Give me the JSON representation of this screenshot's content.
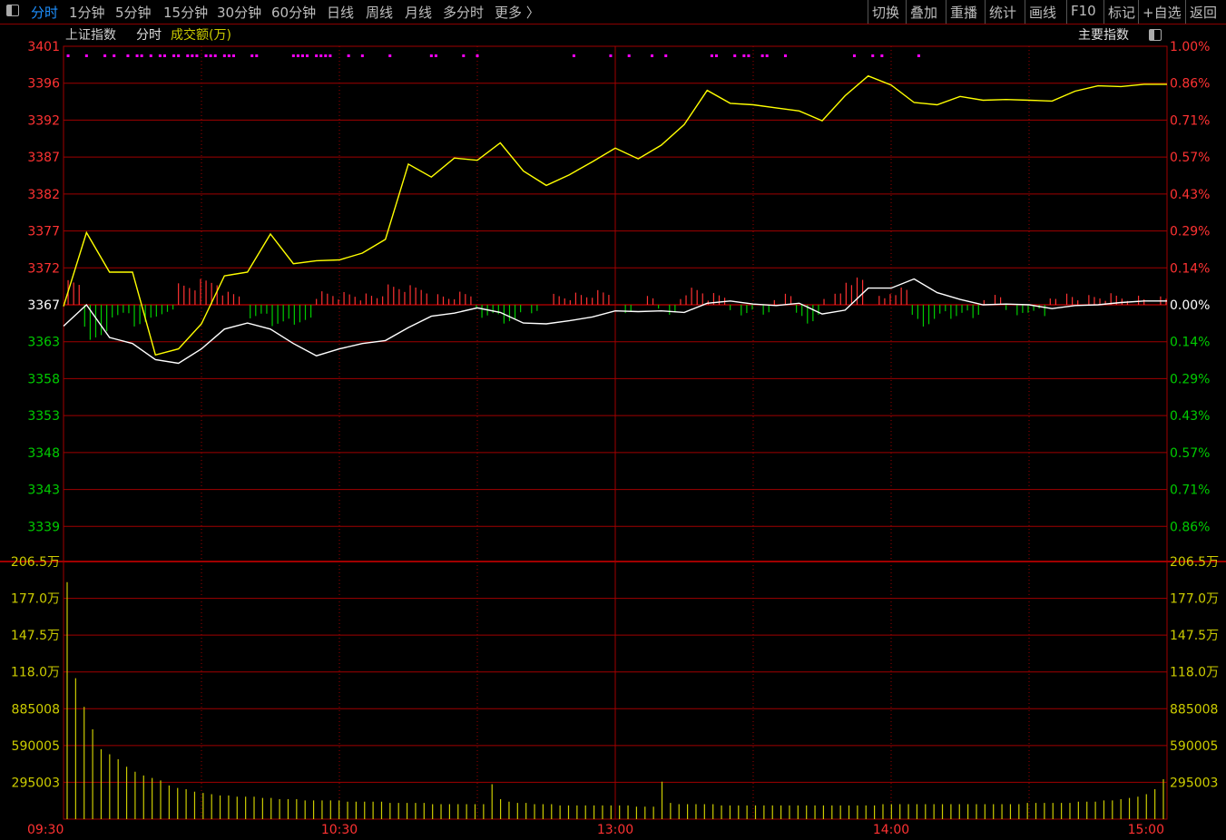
{
  "toolbar": {
    "left_items": [
      "分时",
      "1分钟",
      "5分钟",
      "15分钟",
      "30分钟",
      "60分钟",
      "日线",
      "周线",
      "月线",
      "多分时",
      "更多 〉"
    ],
    "active_index": 0,
    "right_items": [
      "切换",
      "叠加",
      "重播",
      "统计",
      "画线",
      "F10",
      "标记",
      "+自选",
      "返回"
    ]
  },
  "header": {
    "index_name": "上证指数",
    "mode": "分时",
    "volume_label": "成交额(万)",
    "right_label": "主要指数"
  },
  "colors": {
    "background": "#000000",
    "grid": "#a00000",
    "up": "#ff3232",
    "down": "#00cc00",
    "price_line": "#ffffff",
    "avg_line": "#ffff00",
    "volume": "#cccc00",
    "marker": "#ff00ff",
    "tab_active": "#1e90ff"
  },
  "chart_data": {
    "type": "line",
    "price_axis": {
      "left_ticks": [
        "3401",
        "3396",
        "3392",
        "3387",
        "3382",
        "3377",
        "3372",
        "3367",
        "3363",
        "3358",
        "3353",
        "3348",
        "3343",
        "3339"
      ],
      "right_ticks": [
        "1.00%",
        "0.86%",
        "0.71%",
        "0.57%",
        "0.43%",
        "0.29%",
        "0.14%",
        "0.00%",
        "0.14%",
        "0.29%",
        "0.43%",
        "0.57%",
        "0.71%",
        "0.86%"
      ],
      "ylim": [
        3333.7,
        3401.0
      ],
      "prev_close": 3367
    },
    "volume_axis": {
      "ticks": [
        "206.5万",
        "177.0万",
        "147.5万",
        "118.0万",
        "885008",
        "590005",
        "295003"
      ]
    },
    "time_ticks": [
      "09:30",
      "10:30",
      "13:00",
      "14:00",
      "15:00"
    ],
    "series": [
      {
        "name": "",
        "color": "yellow",
        "x": [
          0,
          5,
          10,
          15,
          20,
          25,
          30,
          35,
          40,
          45,
          50,
          55,
          60,
          65,
          70,
          75,
          80,
          85,
          90,
          95,
          100,
          105,
          110,
          115,
          120,
          125,
          130,
          135,
          140,
          145,
          150,
          155,
          160,
          165,
          170,
          175,
          180,
          185,
          190,
          195,
          200,
          205,
          210,
          215,
          220,
          225,
          230,
          235,
          240
        ],
        "y": [
          3366.8,
          3376.5,
          3371.3,
          3371.3,
          3360.4,
          3361.2,
          3364.5,
          3370.8,
          3371.3,
          3376.3,
          3372.4,
          3372.8,
          3372.9,
          3373.8,
          3375.6,
          3385.5,
          3383.8,
          3386.3,
          3386.0,
          3388.3,
          3384.6,
          3382.7,
          3384.1,
          3385.8,
          3387.6,
          3386.2,
          3388.0,
          3390.7,
          3395.2,
          3393.5,
          3393.3,
          3392.9,
          3392.5,
          3391.2,
          3394.5,
          3397.1,
          3395.9,
          3393.6,
          3393.3,
          3394.4,
          3393.9,
          3394.0,
          3393.9,
          3393.8,
          3395.1,
          3395.8,
          3395.7,
          3396.0,
          3396.0
        ]
      },
      {
        "name": "",
        "color": "white",
        "x": [
          0,
          5,
          10,
          15,
          20,
          25,
          30,
          35,
          40,
          45,
          50,
          55,
          60,
          65,
          70,
          75,
          80,
          85,
          90,
          95,
          100,
          105,
          110,
          115,
          120,
          125,
          130,
          135,
          140,
          145,
          150,
          155,
          160,
          165,
          170,
          175,
          180,
          185,
          190,
          195,
          200,
          205,
          210,
          215,
          220,
          225,
          230,
          235,
          240
        ],
        "y": [
          3364.2,
          3367.0,
          3362.7,
          3361.9,
          3359.8,
          3359.3,
          3361.2,
          3363.8,
          3364.6,
          3363.8,
          3361.9,
          3360.3,
          3361.2,
          3361.9,
          3362.3,
          3364.0,
          3365.5,
          3365.9,
          3366.6,
          3366.0,
          3364.6,
          3364.5,
          3364.9,
          3365.4,
          3366.2,
          3366.1,
          3366.2,
          3366.0,
          3367.2,
          3367.5,
          3367.1,
          3366.9,
          3367.2,
          3365.8,
          3366.3,
          3369.2,
          3369.2,
          3370.4,
          3368.6,
          3367.7,
          3367.0,
          3367.1,
          3367.0,
          3366.5,
          3366.9,
          3367.0,
          3367.3,
          3367.5,
          3367.5
        ]
      }
    ],
    "volume_values_wan": [
      190,
      113,
      90,
      72,
      56,
      52,
      48,
      42,
      38,
      35,
      33,
      31,
      27,
      25,
      24,
      22,
      21,
      20,
      19,
      19,
      18,
      18,
      18,
      17,
      17,
      16,
      16,
      16,
      15,
      15,
      15,
      15,
      15,
      14,
      14,
      14,
      14,
      14,
      13,
      13,
      13,
      13,
      13,
      12,
      12,
      12,
      12,
      12,
      12,
      12,
      28,
      16,
      14,
      13,
      13,
      12,
      12,
      12,
      11,
      11,
      11,
      11,
      11,
      11,
      11,
      11,
      11,
      10,
      10,
      10,
      30,
      13,
      12,
      12,
      12,
      12,
      12,
      11,
      11,
      11,
      11,
      11,
      11,
      11,
      11,
      11,
      11,
      11,
      11,
      11,
      11,
      11,
      11,
      11,
      11,
      11,
      12,
      12,
      12,
      12,
      12,
      12,
      12,
      12,
      12,
      12,
      12,
      12,
      12,
      12,
      12,
      12,
      12,
      13,
      13,
      13,
      13,
      13,
      13,
      14,
      14,
      14,
      15,
      15,
      16,
      17,
      18,
      20,
      24,
      32
    ],
    "volume_ylim": [
      0,
      206.5
    ]
  }
}
